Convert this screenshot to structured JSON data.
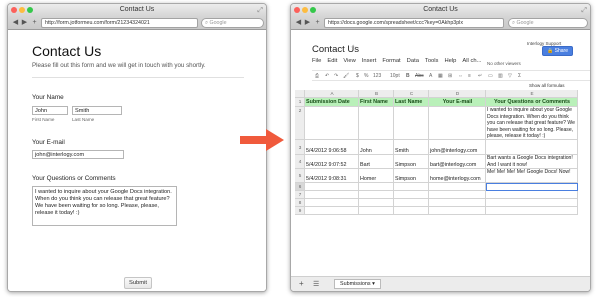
{
  "left_window": {
    "title": "Contact Us",
    "url": "http://form.jotformeu.com/form/21234324021",
    "search_placeholder": "Google",
    "form": {
      "title": "Contact Us",
      "subtitle": "Please fill out this form and we will get in touch with you shortly.",
      "name_label": "Your Name",
      "first_name_value": "John",
      "last_name_value": "Smith",
      "first_name_sublabel": "First Name",
      "last_name_sublabel": "Last Name",
      "email_label": "Your E-mail",
      "email_value": "john@interlogy.com",
      "comments_label": "Your Questions or Comments",
      "comments_value": "I wanted to inquire about your Google Docs integration. When do you think you can release that great feature? We have been waiting for so long. Please, please, release it today! :)",
      "submit_label": "Submit"
    }
  },
  "right_window": {
    "title": "Contact Us",
    "url": "https://docs.google.com/spreadsheet/ccc?key=0Akhp3plx",
    "search_placeholder": "Google",
    "sheet_title": "Contact Us",
    "support_label": "Interlogy Support",
    "share_label": "Share",
    "menu": [
      "File",
      "Edit",
      "View",
      "Insert",
      "Format",
      "Data",
      "Tools",
      "Help",
      "All ch..."
    ],
    "no_viewers": "No other viewers",
    "toolbar_items": [
      "$",
      "%",
      "123",
      "10pt",
      "B",
      "Abc",
      "A"
    ],
    "show_formulas": "Show all formulas",
    "fx": "fx",
    "column_letters": [
      "A",
      "B",
      "C",
      "D",
      "E"
    ],
    "headers": [
      "Submission Date",
      "First Name",
      "Last Name",
      "Your E-mail",
      "Your Questions or Comments"
    ],
    "rows": [
      {
        "num": "2",
        "date": "",
        "first": "",
        "last": "",
        "email": "",
        "comment": "I wanted to inquire about your Google Docs integration. When do you think you can release that great feature? We have been waiting for so long. Please, please, release it today! :)"
      },
      {
        "num": "3",
        "date": "5/4/2012 9:06:58",
        "first": "John",
        "last": "Smith",
        "email": "john@interlogy.com",
        "comment": ""
      },
      {
        "num": "4",
        "date": "5/4/2012 9:07:52",
        "first": "Bart",
        "last": "Simpson",
        "email": "bart@interlogy.com",
        "comment": "Bart wants a Google Docs integration! And I want it now!"
      },
      {
        "num": "5",
        "date": "5/4/2012 9:08:31",
        "first": "Homer",
        "last": "Simpson",
        "email": "home@interlogy.com",
        "comment": "Me! Me! Me! Me! Google Docs! Now!"
      },
      {
        "num": "6",
        "date": "",
        "first": "",
        "last": "",
        "email": "",
        "comment": ""
      },
      {
        "num": "7",
        "date": "",
        "first": "",
        "last": "",
        "email": "",
        "comment": ""
      },
      {
        "num": "8",
        "date": "",
        "first": "",
        "last": "",
        "email": "",
        "comment": ""
      },
      {
        "num": "9",
        "date": "",
        "first": "",
        "last": "",
        "email": "",
        "comment": ""
      }
    ],
    "sheet_tab": "Submissions",
    "add_sheet": "+"
  },
  "colors": {
    "arrow": "#f05a3c",
    "header_green": "#b9f0b9",
    "share": "#4a7fe0"
  }
}
